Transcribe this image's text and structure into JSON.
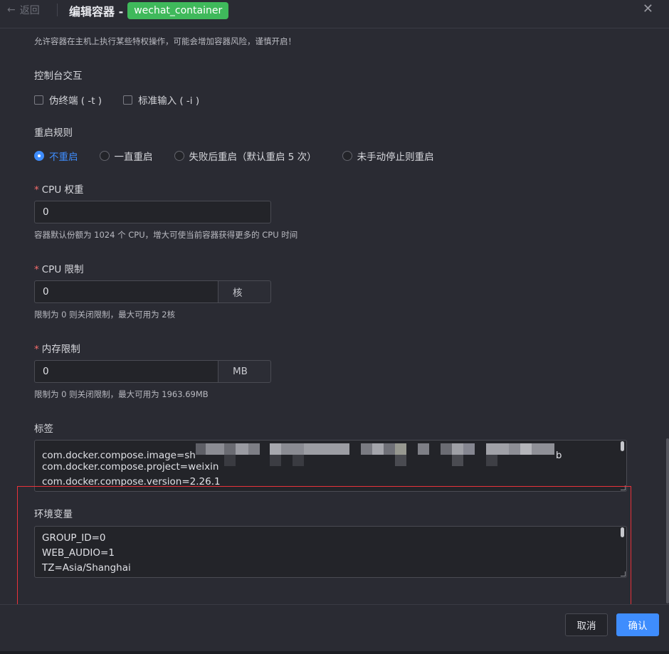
{
  "header": {
    "back_label": "返回",
    "title": "编辑容器 -",
    "container_name": "wechat_container"
  },
  "privileged": {
    "hint": "允许容器在主机上执行某些特权操作，可能会增加容器风险，谨慎开启！"
  },
  "console": {
    "label": "控制台交互",
    "options": [
      {
        "label": "伪终端 ( -t )",
        "checked": false
      },
      {
        "label": "标准输入 ( -i )",
        "checked": false
      }
    ]
  },
  "restart": {
    "label": "重启规则",
    "options": [
      {
        "label": "不重启",
        "checked": true
      },
      {
        "label": "一直重启",
        "checked": false
      },
      {
        "label": "失败后重启（默认重启 5 次）",
        "checked": false
      },
      {
        "label": "未手动停止则重启",
        "checked": false
      }
    ]
  },
  "cpu_weight": {
    "required": "*",
    "label": "CPU 权重",
    "value": "0",
    "hint": "容器默认份额为 1024 个 CPU，增大可使当前容器获得更多的 CPU 时间"
  },
  "cpu_limit": {
    "required": "*",
    "label": "CPU 限制",
    "value": "0",
    "unit": "核",
    "hint": "限制为 0 则关闭限制，最大可用为 2核"
  },
  "memory_limit": {
    "required": "*",
    "label": "内存限制",
    "value": "0",
    "unit": "MB",
    "hint": "限制为 0 则关闭限制，最大可用为 1963.69MB"
  },
  "labels": {
    "label": "标签",
    "lines": [
      {
        "prefix": "com.docker.compose.image=sh",
        "suffix": "b"
      },
      {
        "text": "com.docker.compose.project=weixin"
      },
      {
        "text": "com.docker.compose.version=2.26.1"
      }
    ]
  },
  "env": {
    "label": "环境变量",
    "lines": [
      "GROUP_ID=0",
      "WEB_AUDIO=1",
      "TZ=Asia/Shanghai"
    ]
  },
  "footer": {
    "cancel_label": "取消",
    "confirm_label": "确认"
  },
  "colors": {
    "accent": "#3f8dfd",
    "tag": "#3fb95b",
    "highlight": "#e8323a",
    "required": "#f56c6c"
  }
}
